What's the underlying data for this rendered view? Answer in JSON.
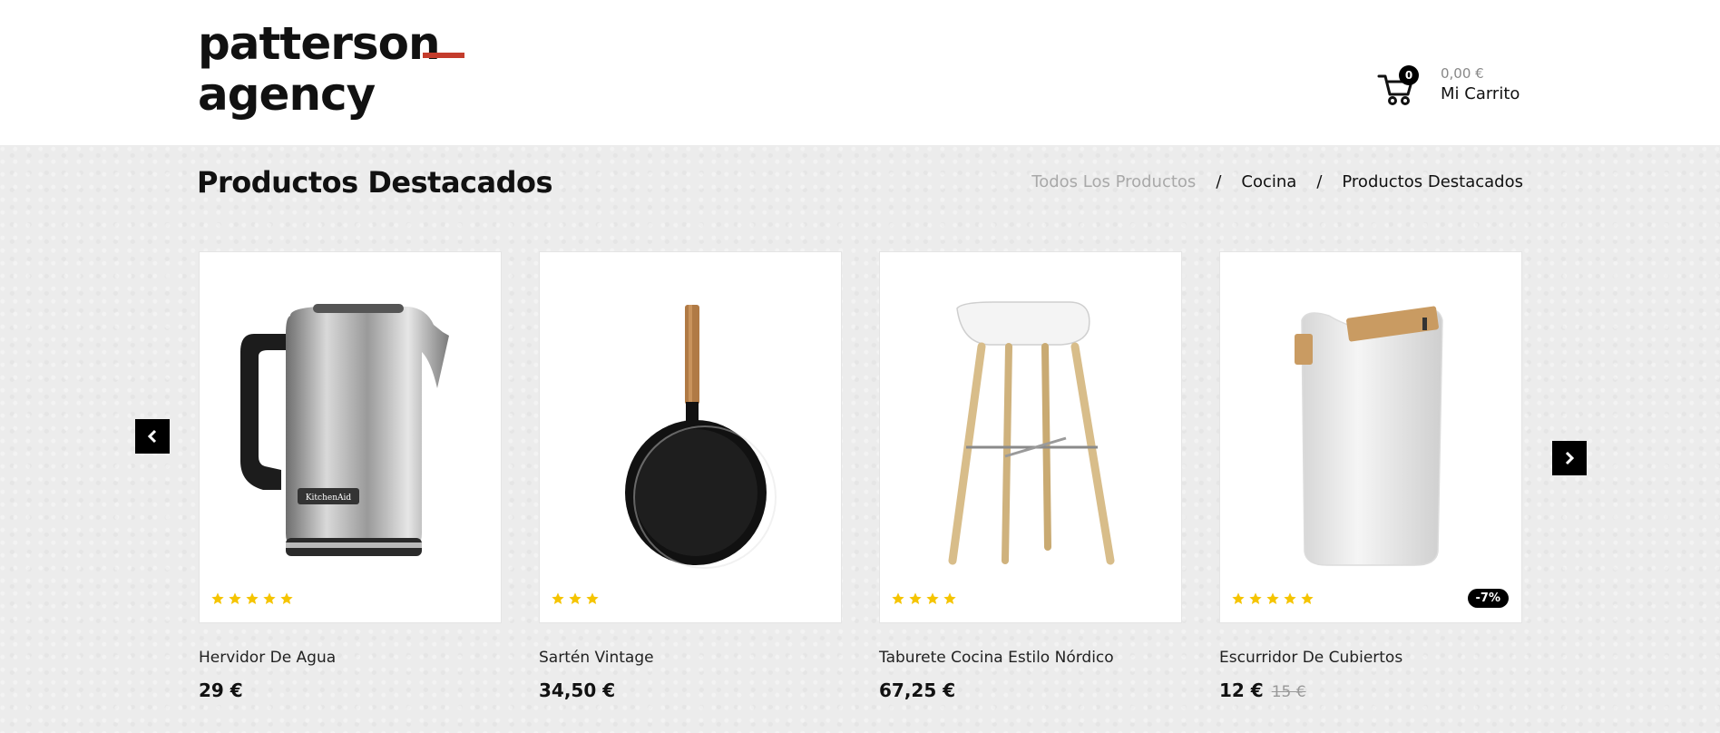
{
  "brand": {
    "logo_line1": "patterson",
    "logo_line2": "agency",
    "accent_color": "#c43c2c"
  },
  "cart": {
    "count": "0",
    "total": "0,00 €",
    "label": "Mi Carrito",
    "icon": "shopping-cart-icon"
  },
  "page": {
    "title": "Productos Destacados"
  },
  "breadcrumb": {
    "items": [
      "Todos Los Productos",
      "Cocina",
      "Productos Destacados"
    ],
    "separator": "/"
  },
  "carousel": {
    "prev_icon": "chevron-left-icon",
    "next_icon": "chevron-right-icon"
  },
  "products": [
    {
      "name": "Hervidor De Agua",
      "price": "29 €",
      "old_price": "",
      "rating": 5,
      "badge": "",
      "image": "electric-kettle"
    },
    {
      "name": "Sartén Vintage",
      "price": "34,50 €",
      "old_price": "",
      "rating": 3,
      "badge": "",
      "image": "frying-pan"
    },
    {
      "name": "Taburete Cocina Estilo Nórdico",
      "price": "67,25 €",
      "old_price": "",
      "rating": 4,
      "badge": "",
      "image": "bar-stool"
    },
    {
      "name": "Escurridor De Cubiertos",
      "price": "12 €",
      "old_price": "15 €",
      "rating": 5,
      "badge": "-7%",
      "image": "utensil-holder"
    }
  ],
  "colors": {
    "star": "#f5c400",
    "arrow_bg": "#000000",
    "muted_text": "#a9a9a9"
  }
}
